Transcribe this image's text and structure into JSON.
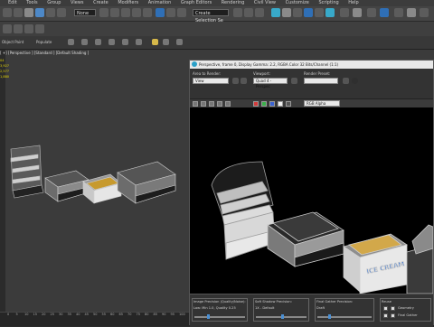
{
  "menu": {
    "items": [
      "Edit",
      "Tools",
      "Group",
      "Views",
      "Create",
      "Modifiers",
      "Animation",
      "Graph Editors",
      "Rendering",
      "Civil View",
      "Customize",
      "Scripting",
      "Help"
    ]
  },
  "toolbar": {
    "selection_filter": "None",
    "named_selection_placeholder": "Create Selection Se"
  },
  "ribbon": {
    "label_1": "Object Paint",
    "label_2": "Populate"
  },
  "viewport": {
    "label": "[ +] [Perspective ] [Standard ] [Default Shading ]",
    "stats": [
      "04",
      "3,927",
      "2,577",
      "",
      "1,880"
    ]
  },
  "timeline": {
    "ticks": [
      "0",
      "5",
      "10",
      "15",
      "20",
      "25",
      "30",
      "35",
      "40",
      "45",
      "50",
      "55",
      "60",
      "65",
      "70",
      "75",
      "80",
      "85",
      "90",
      "95",
      "100"
    ]
  },
  "render_window": {
    "title": "Perspective, frame 0, Display Gamma: 2.2, RGBA Color 32 Bits/Channel (1:1)",
    "area_label": "Area to Render:",
    "area_value": "View",
    "viewport_label": "Viewport:",
    "viewport_value": "Quad 4 - Perspec",
    "preset_label": "Render Preset:",
    "preset_value": "",
    "channel_value": "RGB Alpha",
    "bottom": {
      "image_precision_label": "Image Precision (Quality/Noise):",
      "image_precision_value": "Low: Min 1.0, Quality 0.25",
      "soft_shadow_label": "Soft Shadow Precision:",
      "soft_shadow_value": "1X - Default",
      "final_gather_label": "Final Gather Precision:",
      "final_gather_value": "Draft",
      "reuse_label": "Reuse",
      "geometry_label": "Geometry",
      "final_gather_check_label": "Final Gather"
    },
    "sign_text": "ICE CREAM"
  }
}
